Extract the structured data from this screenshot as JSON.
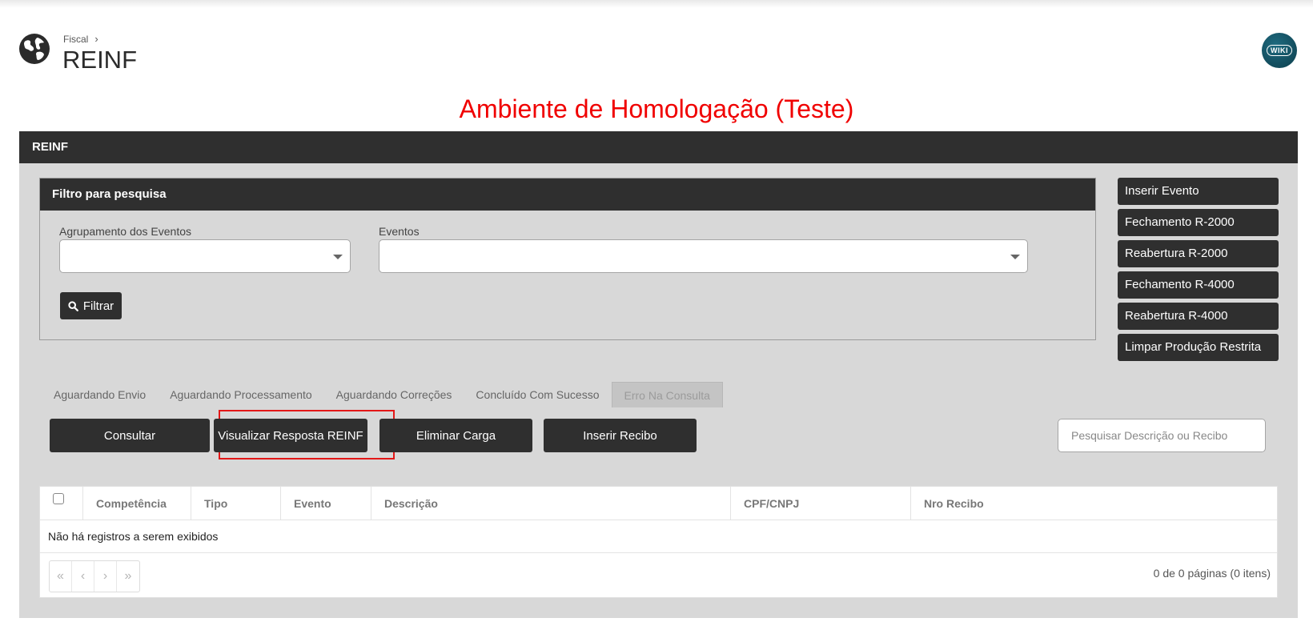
{
  "header": {
    "breadcrumb": "Fiscal",
    "title": "REINF",
    "wiki_label": "WIKI"
  },
  "environment_banner": "Ambiente de Homologação (Teste)",
  "panel": {
    "title": "REINF",
    "filter": {
      "title": "Filtro para pesquisa",
      "group_label": "Agrupamento dos Eventos",
      "group_value": "",
      "events_label": "Eventos",
      "events_value": "",
      "filter_button": "Filtrar"
    },
    "side_buttons": [
      "Inserir Evento",
      "Fechamento R-2000",
      "Reabertura R-2000",
      "Fechamento R-4000",
      "Reabertura R-4000",
      "Limpar Produção Restrita"
    ],
    "tabs": [
      "Aguardando Envio",
      "Aguardando Processamento",
      "Aguardando Correções",
      "Concluído Com Sucesso",
      "Erro Na Consulta"
    ],
    "active_tab": "Erro Na Consulta",
    "actions": {
      "consultar": "Consultar",
      "visualizar": "Visualizar Resposta REINF",
      "eliminar": "Eliminar Carga",
      "inserir_recibo": "Inserir Recibo"
    },
    "search": {
      "placeholder": "Pesquisar Descrição ou Recibo",
      "value": ""
    },
    "grid": {
      "columns": [
        "Competência",
        "Tipo",
        "Evento",
        "Descrição",
        "CPF/CNPJ",
        "Nro Recibo"
      ],
      "empty_message": "Não há registros a serem exibidos",
      "pager_info": "0 de 0 páginas (0 itens)"
    }
  },
  "colors": {
    "banner": "#f00000",
    "dark": "#2f2f2f",
    "panel_bg": "#d8d8d8",
    "highlight": "#e31717"
  }
}
